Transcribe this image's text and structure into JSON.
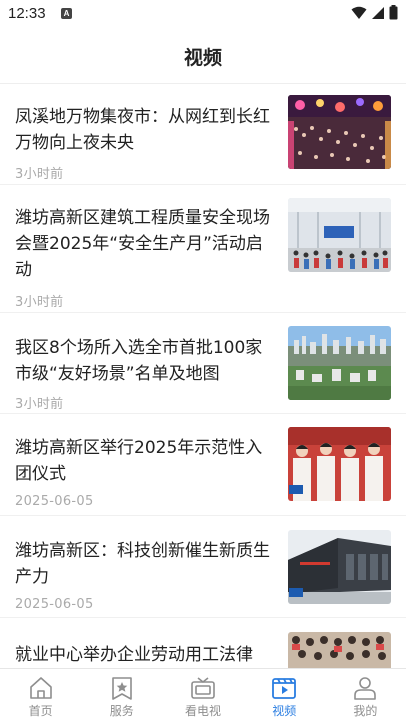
{
  "status_bar": {
    "time": "12:33",
    "notification": "A"
  },
  "header": {
    "title": "视频"
  },
  "news": [
    {
      "title": "凤溪地万物集夜市：从网红到长红  万物向上夜未央",
      "time": "3小时前",
      "thumb": "night-market-crowd"
    },
    {
      "title": "潍坊高新区建筑工程质量安全现场会暨2025年“安全生产月”活动启动",
      "time": "3小时前",
      "thumb": "industrial-hall-meeting"
    },
    {
      "title": "我区8个场所入选全市首批100家市级“友好场景”名单及地图",
      "time": "3小时前",
      "thumb": "city-aerial-view"
    },
    {
      "title": "潍坊高新区举行2025年示范性入团仪式",
      "time": "2025-06-05",
      "thumb": "youth-oath-ceremony"
    },
    {
      "title": "潍坊高新区：科技创新催生新质生产力",
      "time": "2025-06-05",
      "thumb": "factory-building"
    },
    {
      "title": "就业中心举办企业劳动用工法律",
      "time": "",
      "thumb": "seminar-audience"
    }
  ],
  "tabs": [
    {
      "label": "首页",
      "icon": "home-icon",
      "active": false
    },
    {
      "label": "服务",
      "icon": "star-bookmark-icon",
      "active": false
    },
    {
      "label": "看电视",
      "icon": "tv-icon",
      "active": false
    },
    {
      "label": "视频",
      "icon": "video-play-icon",
      "active": true
    },
    {
      "label": "我的",
      "icon": "user-icon",
      "active": false
    }
  ],
  "colors": {
    "accent": "#2a7de1",
    "tab_inactive": "#8e8e8e",
    "meta_text": "#aaaaaa"
  }
}
